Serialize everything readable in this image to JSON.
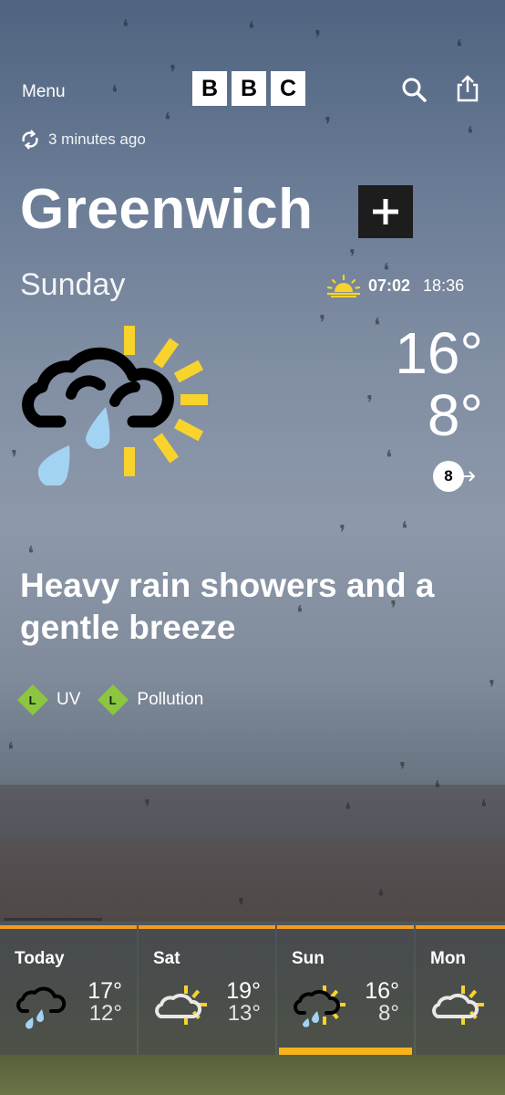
{
  "header": {
    "menu_label": "Menu",
    "logo_letters": [
      "B",
      "B",
      "C"
    ]
  },
  "updated": {
    "text": "3 minutes ago",
    "icon": "refresh-icon"
  },
  "location": {
    "name": "Greenwich",
    "favourite_icon": "plus-icon"
  },
  "today": {
    "day": "Sunday",
    "sunrise": "07:02",
    "sunset": "18:36",
    "high": "16°",
    "low": "8°",
    "wind_speed": "8",
    "weather_icon": "heavy-rain-showers-sun-icon",
    "summary": "Heavy rain showers and a gentle breeze"
  },
  "indices": [
    {
      "level": "L",
      "label": "UV"
    },
    {
      "level": "L",
      "label": "Pollution"
    }
  ],
  "forecast": [
    {
      "day": "Today",
      "high": "17°",
      "low": "12°",
      "icon": "rain-cloud-icon"
    },
    {
      "day": "Sat",
      "high": "19°",
      "low": "13°",
      "icon": "sun-cloud-icon"
    },
    {
      "day": "Sun",
      "high": "16°",
      "low": "8°",
      "icon": "rain-sun-icon",
      "selected": true
    },
    {
      "day": "Mon",
      "high": "",
      "low": "",
      "icon": "sun-cloud-icon"
    }
  ],
  "colors": {
    "sun_yellow": "#f8d32b",
    "rain_blue": "#a3d3f2",
    "accent_orange": "#f39a1f",
    "level_green": "#8cc63f"
  }
}
